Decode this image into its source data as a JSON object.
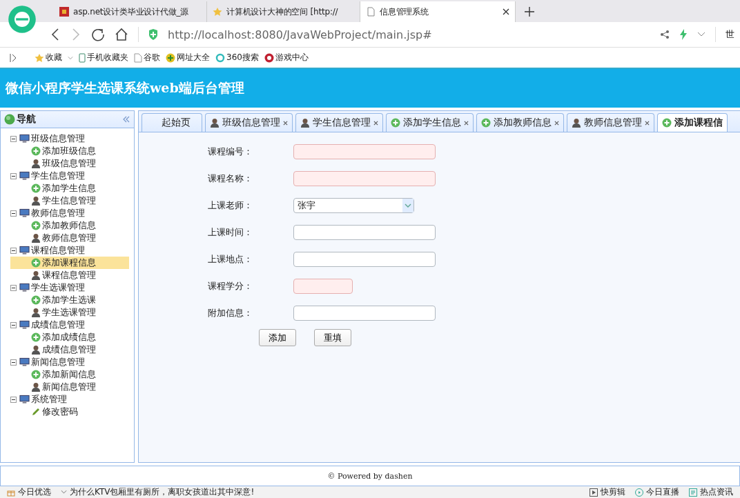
{
  "browser": {
    "tabs": [
      {
        "title": "asp.net设计类毕业设计代做_源",
        "selected": false
      },
      {
        "title": "计算机设计大神的空间 [http://",
        "selected": false
      },
      {
        "title": "信息管理系统",
        "selected": true
      }
    ],
    "url": "http://localhost:8080/JavaWebProject/main.jsp#",
    "right_text": "世",
    "bookmarks": [
      {
        "label": "收藏"
      },
      {
        "label": "手机收藏夹"
      },
      {
        "label": "谷歌"
      },
      {
        "label": "网址大全"
      },
      {
        "label": "360搜索"
      },
      {
        "label": "游戏中心"
      }
    ]
  },
  "header": {
    "title": "微信小程序学生选课系统web端后台管理"
  },
  "sidebar": {
    "title": "导航",
    "items": [
      {
        "label": "班级信息管理",
        "expanded": true,
        "children": [
          {
            "label": "添加班级信息",
            "kind": "add",
            "selected": false
          },
          {
            "label": "班级信息管理",
            "kind": "manage",
            "selected": false
          }
        ]
      },
      {
        "label": "学生信息管理",
        "expanded": true,
        "children": [
          {
            "label": "添加学生信息",
            "kind": "add",
            "selected": false
          },
          {
            "label": "学生信息管理",
            "kind": "manage",
            "selected": false
          }
        ]
      },
      {
        "label": "教师信息管理",
        "expanded": true,
        "children": [
          {
            "label": "添加教师信息",
            "kind": "add",
            "selected": false
          },
          {
            "label": "教师信息管理",
            "kind": "manage",
            "selected": false
          }
        ]
      },
      {
        "label": "课程信息管理",
        "expanded": true,
        "children": [
          {
            "label": "添加课程信息",
            "kind": "add",
            "selected": true
          },
          {
            "label": "课程信息管理",
            "kind": "manage",
            "selected": false
          }
        ]
      },
      {
        "label": "学生选课管理",
        "expanded": true,
        "children": [
          {
            "label": "添加学生选课",
            "kind": "add",
            "selected": false
          },
          {
            "label": "学生选课管理",
            "kind": "manage",
            "selected": false
          }
        ]
      },
      {
        "label": "成绩信息管理",
        "expanded": true,
        "children": [
          {
            "label": "添加成绩信息",
            "kind": "add",
            "selected": false
          },
          {
            "label": "成绩信息管理",
            "kind": "manage",
            "selected": false
          }
        ]
      },
      {
        "label": "新闻信息管理",
        "expanded": true,
        "children": [
          {
            "label": "添加新闻信息",
            "kind": "add",
            "selected": false
          },
          {
            "label": "新闻信息管理",
            "kind": "manage",
            "selected": false
          }
        ]
      },
      {
        "label": "系统管理",
        "expanded": true,
        "children": [
          {
            "label": "修改密码",
            "kind": "edit",
            "selected": false
          }
        ]
      }
    ]
  },
  "content_tabs": [
    {
      "label": "起始页",
      "kind": "none",
      "closable": false,
      "selected": false
    },
    {
      "label": "班级信息管理",
      "kind": "manage",
      "closable": true,
      "selected": false
    },
    {
      "label": "学生信息管理",
      "kind": "manage",
      "closable": true,
      "selected": false
    },
    {
      "label": "添加学生信息",
      "kind": "add",
      "closable": true,
      "selected": false
    },
    {
      "label": "添加教师信息",
      "kind": "add",
      "closable": true,
      "selected": false
    },
    {
      "label": "教师信息管理",
      "kind": "manage",
      "closable": true,
      "selected": false
    },
    {
      "label": "添加课程信",
      "kind": "add",
      "closable": false,
      "selected": true
    }
  ],
  "form": {
    "fields": [
      {
        "label": "课程编号：",
        "kind": "text",
        "invalid": true
      },
      {
        "label": "课程名称：",
        "kind": "text",
        "invalid": true
      },
      {
        "label": "上课老师：",
        "kind": "select",
        "value": "张宇",
        "invalid": false
      },
      {
        "label": "上课时间：",
        "kind": "text",
        "invalid": false
      },
      {
        "label": "上课地点：",
        "kind": "text",
        "invalid": false
      },
      {
        "label": "课程学分：",
        "kind": "text",
        "invalid": true
      },
      {
        "label": "附加信息：",
        "kind": "text",
        "invalid": false
      }
    ],
    "buttons": [
      "添加",
      "重填"
    ]
  },
  "footer": {
    "text": "© Powered by dashen"
  },
  "status_bar": {
    "left": [
      "今日优选",
      "为什么KTV包厢里有厕所，离职女孩道出其中深意!"
    ],
    "right": [
      "快剪辑",
      "今日直播",
      "热点资讯"
    ]
  }
}
